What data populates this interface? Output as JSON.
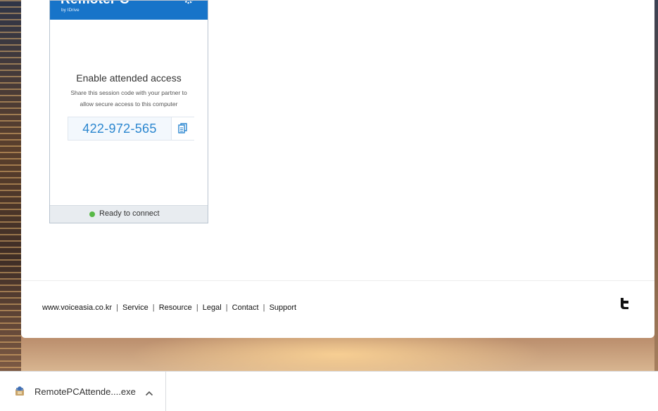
{
  "widget": {
    "brand_name": "RemotePC",
    "brand_sub": "by IDrive",
    "title": "Enable attended access",
    "description_line1": "Share this session code with your partner to",
    "description_line2": "allow secure access to this computer",
    "session_code": "422-972-565",
    "status_text": "Ready to connect",
    "status_color": "#58b947",
    "header_color": "#1774c9"
  },
  "footer": {
    "links": [
      {
        "label": "www.voiceasia.co.kr"
      },
      {
        "label": "Service"
      },
      {
        "label": "Resource"
      },
      {
        "label": "Legal"
      },
      {
        "label": "Contact"
      },
      {
        "label": "Support"
      }
    ],
    "separator": "|",
    "social_icon": "twitter-icon"
  },
  "download_bar": {
    "file_name": "RemotePCAttende....exe",
    "file_icon": "installer-icon",
    "menu_icon": "chevron-up-icon"
  }
}
